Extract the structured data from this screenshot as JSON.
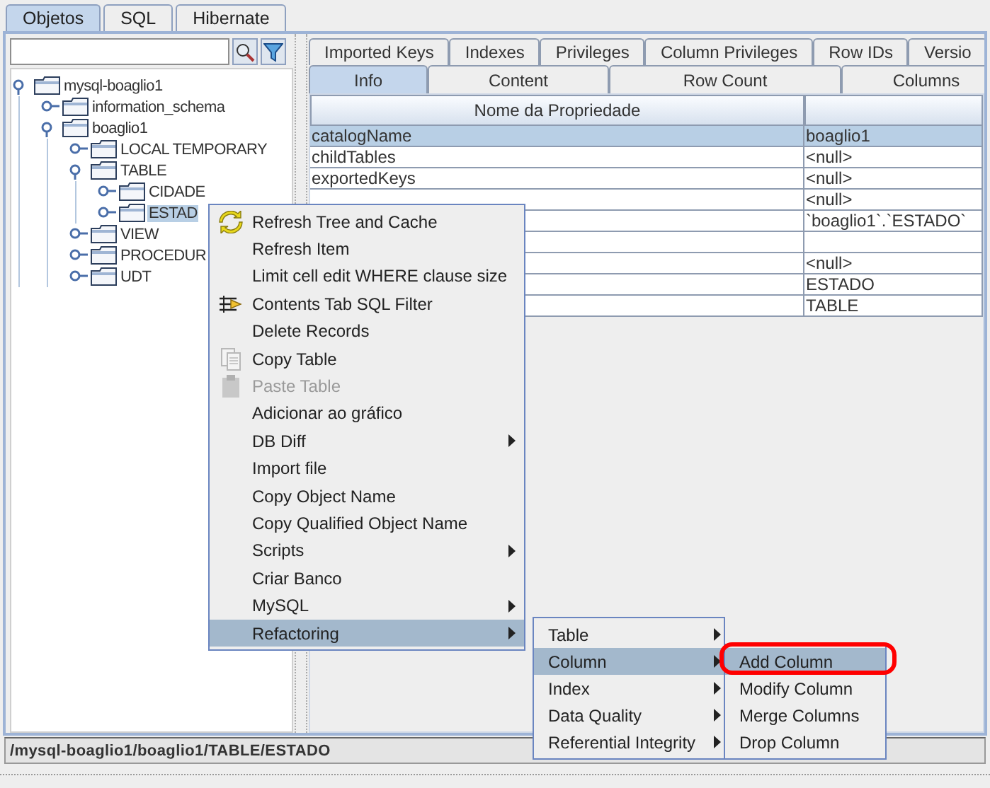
{
  "top_tabs": [
    {
      "label": "Objetos",
      "selected": true
    },
    {
      "label": "SQL",
      "selected": false
    },
    {
      "label": "Hibernate",
      "selected": false
    }
  ],
  "tree": [
    {
      "label": "mysql-boaglio1",
      "expanded": true,
      "selected": false,
      "children": [
        {
          "label": "information_schema",
          "expanded": false,
          "selected": false
        },
        {
          "label": "boaglio1",
          "expanded": true,
          "selected": false,
          "children": [
            {
              "label": "LOCAL TEMPORARY",
              "expanded": false,
              "selected": false
            },
            {
              "label": "TABLE",
              "expanded": true,
              "selected": false,
              "children": [
                {
                  "label": "CIDADE",
                  "expanded": false,
                  "selected": false
                },
                {
                  "label": "ESTAD",
                  "expanded": false,
                  "selected": true
                }
              ]
            },
            {
              "label": "VIEW",
              "expanded": false,
              "selected": false
            },
            {
              "label": "PROCEDUR",
              "expanded": false,
              "selected": false
            },
            {
              "label": "UDT",
              "expanded": false,
              "selected": false
            }
          ]
        }
      ]
    }
  ],
  "detail_tabs_back": [
    {
      "label": "Imported Keys"
    },
    {
      "label": "Indexes"
    },
    {
      "label": "Privileges"
    },
    {
      "label": "Column Privileges"
    },
    {
      "label": "Row IDs"
    },
    {
      "label": "Versio"
    }
  ],
  "detail_tabs": [
    {
      "label": "Info",
      "selected": true
    },
    {
      "label": "Content",
      "selected": false
    },
    {
      "label": "Row Count",
      "selected": false
    },
    {
      "label": "Columns",
      "selected": false
    }
  ],
  "table": {
    "columns": [
      "Nome da Propriedade"
    ],
    "rows": [
      {
        "name": "catalogName",
        "value": "boaglio1",
        "selected": true
      },
      {
        "name": "childTables",
        "value": "<null>",
        "selected": false
      },
      {
        "name": "exportedKeys",
        "value": "<null>",
        "selected": false
      },
      {
        "value": "<null>",
        "selected": false
      },
      {
        "value": "`boaglio1`.`ESTADO`",
        "selected": false
      },
      {
        "selected": false
      },
      {
        "value": "<null>",
        "selected": false
      },
      {
        "value": "ESTADO",
        "selected": false
      },
      {
        "value": "TABLE",
        "selected": false
      }
    ]
  },
  "status_bar": "/mysql-boaglio1/boaglio1/TABLE/ESTADO",
  "context_menu": [
    {
      "label": "Refresh Tree and Cache",
      "kind": "refresh",
      "disabled": false,
      "submenu": false,
      "selected": false
    },
    {
      "label": "Refresh Item",
      "disabled": false,
      "submenu": false,
      "selected": false
    },
    {
      "label": "Limit cell edit WHERE clause size",
      "disabled": false,
      "submenu": false,
      "selected": false
    },
    {
      "label": "Contents Tab SQL Filter",
      "kind": "filter",
      "disabled": false,
      "submenu": false,
      "selected": false
    },
    {
      "label": "Delete Records",
      "disabled": false,
      "submenu": false,
      "selected": false
    },
    {
      "label": "Copy Table",
      "kind": "copy",
      "disabled": false,
      "submenu": false,
      "selected": false
    },
    {
      "label": "Paste Table",
      "kind": "paste",
      "disabled": true,
      "submenu": false,
      "selected": false
    },
    {
      "label": "Adicionar ao gráfico",
      "disabled": false,
      "submenu": false,
      "selected": false
    },
    {
      "label": "DB Diff",
      "disabled": false,
      "submenu": true,
      "selected": false
    },
    {
      "label": "Import file",
      "disabled": false,
      "submenu": false,
      "selected": false
    },
    {
      "label": "Copy Object Name",
      "disabled": false,
      "submenu": false,
      "selected": false
    },
    {
      "label": "Copy Qualified Object Name",
      "disabled": false,
      "submenu": false,
      "selected": false
    },
    {
      "label": "Scripts",
      "disabled": false,
      "submenu": true,
      "selected": false
    },
    {
      "label": "Criar Banco",
      "disabled": false,
      "submenu": false,
      "selected": false
    },
    {
      "label": "MySQL",
      "disabled": false,
      "submenu": true,
      "selected": false
    },
    {
      "label": "Refactoring",
      "disabled": false,
      "submenu": true,
      "selected": true
    }
  ],
  "refactoring_menu": [
    {
      "label": "Table",
      "submenu": true,
      "selected": false
    },
    {
      "label": "Column",
      "submenu": true,
      "selected": true
    },
    {
      "label": "Index",
      "submenu": true,
      "selected": false
    },
    {
      "label": "Data Quality",
      "submenu": true,
      "selected": false
    },
    {
      "label": "Referential Integrity",
      "submenu": true,
      "selected": false
    }
  ],
  "column_menu": [
    {
      "label": "Add Column",
      "selected": true,
      "highlighted": true
    },
    {
      "label": "Modify Column",
      "selected": false,
      "highlighted": false
    },
    {
      "label": "Merge Columns",
      "selected": false,
      "highlighted": false
    },
    {
      "label": "Drop Column",
      "selected": false,
      "highlighted": false
    }
  ]
}
